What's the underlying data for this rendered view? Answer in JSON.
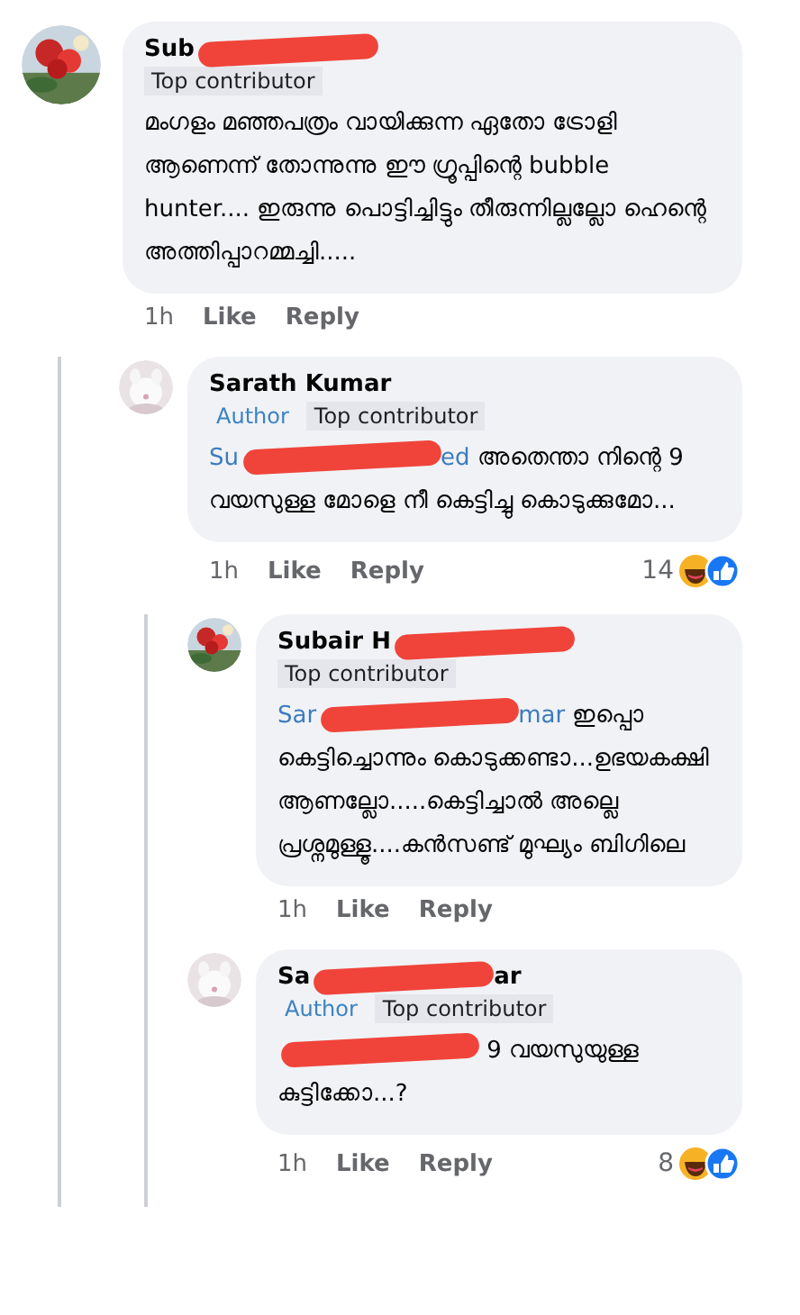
{
  "comments": [
    {
      "name": [
        {
          "kind": "text",
          "text": "Sub"
        },
        {
          "kind": "redacted"
        }
      ],
      "badges": [
        {
          "kind": "top",
          "label": "Top contributor"
        }
      ],
      "text": "മംഗളം മഞ്ഞപത്രം വായിക്കുന്ന ഏതോ ട്രോളി ആണെന്ന് തോന്നുന്നു ഈ ഗ്രൂപ്പിന്റെ bubble hunter.... ഇരുന്നു പൊട്ടിച്ചിട്ടും തീരുന്നില്ലല്ലോ ഹെന്റെ അത്തിപ്പാറമ്മച്ചി.....",
      "time": "1h",
      "actions": [
        "Like",
        "Reply"
      ],
      "children": [
        {
          "name": [
            {
              "kind": "text",
              "text": "Sarath Kumar"
            }
          ],
          "badges": [
            {
              "kind": "author",
              "label": "Author"
            },
            {
              "kind": "top",
              "label": "Top contributor"
            }
          ],
          "mention": [
            {
              "kind": "text",
              "text": "Su"
            },
            {
              "kind": "redacted"
            },
            {
              "kind": "text",
              "text": "ed"
            }
          ],
          "text": "അതെന്താ നിന്റെ 9 വയസുള്ള മോളെ നീ കെട്ടിച്ചു കൊടുക്കുമോ...",
          "time": "1h",
          "actions": [
            "Like",
            "Reply"
          ],
          "reactions": "14",
          "children": [
            {
              "name": [
                {
                  "kind": "text",
                  "text": "Subair H"
                },
                {
                  "kind": "redacted"
                }
              ],
              "badges": [
                {
                  "kind": "top",
                  "label": "Top contributor"
                }
              ],
              "mention": [
                {
                  "kind": "text",
                  "text": "Sar"
                },
                {
                  "kind": "redacted"
                },
                {
                  "kind": "text",
                  "text": "mar"
                }
              ],
              "text": "ഇപ്പൊ കെട്ടിച്ചൊന്നും കൊടുക്കണ്ടാ...ഉഭയകക്ഷി ആണല്ലോ.....കെട്ടിച്ചാൽ അല്ലെ പ്രശ്നമുള്ളൂ....കൻസണ്ട് മുഘ്യം ബിഗിലെ",
              "time": "1h",
              "actions": [
                "Like",
                "Reply"
              ]
            },
            {
              "name": [
                {
                  "kind": "text",
                  "text": "Sa"
                },
                {
                  "kind": "redacted"
                },
                {
                  "kind": "text",
                  "text": "ar"
                }
              ],
              "badges": [
                {
                  "kind": "author",
                  "label": "Author"
                },
                {
                  "kind": "top",
                  "label": "Top contributor"
                }
              ],
              "mention": [
                {
                  "kind": "redacted"
                }
              ],
              "text": "9 വയസുയുള്ള കുട്ടിക്കോ...?",
              "time": "1h",
              "actions": [
                "Like",
                "Reply"
              ],
              "reactions": "8"
            }
          ]
        }
      ]
    }
  ]
}
